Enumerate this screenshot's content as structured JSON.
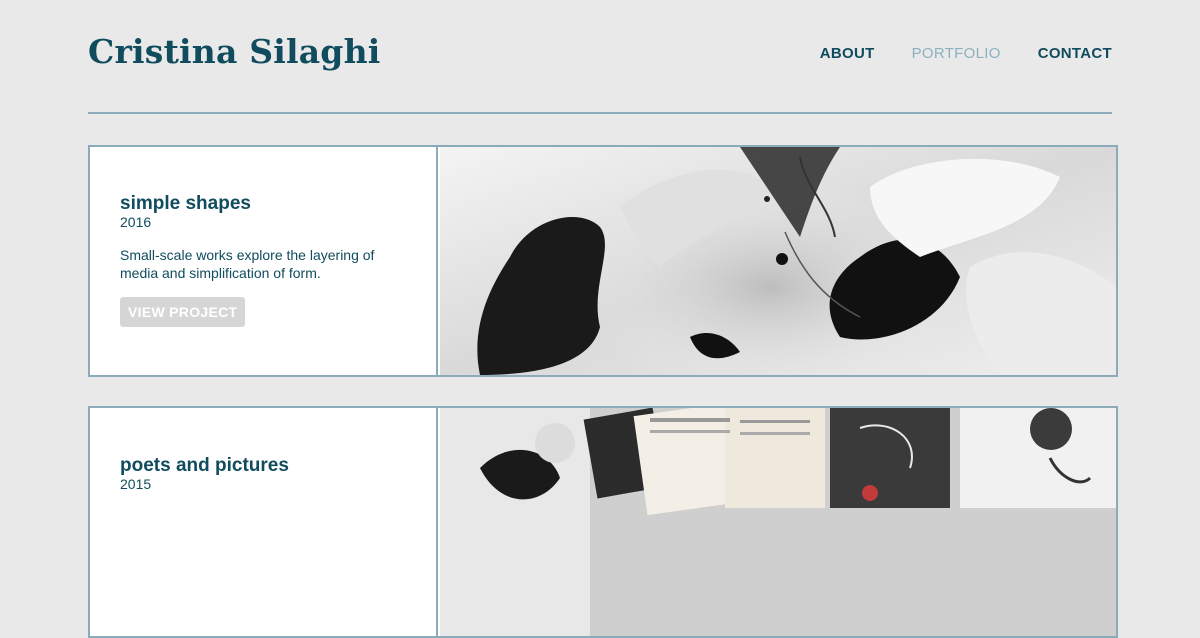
{
  "header": {
    "logo": "Cristina Silaghi",
    "nav": [
      {
        "label": "ABOUT",
        "active": false
      },
      {
        "label": "PORTFOLIO",
        "active": true
      },
      {
        "label": "CONTACT",
        "active": false
      }
    ]
  },
  "projects": [
    {
      "title": "simple shapes",
      "year": "2016",
      "description": "Small-scale works explore the layering of media and simplification of form.",
      "button": "VIEW PROJECT"
    },
    {
      "title": "poets and pictures",
      "year": "2015"
    }
  ],
  "colors": {
    "brand": "#104c5e",
    "active_nav": "#8db0bf",
    "border": "#8cabba",
    "background": "#e9e9e9",
    "button_bg": "#d6d6d6"
  }
}
